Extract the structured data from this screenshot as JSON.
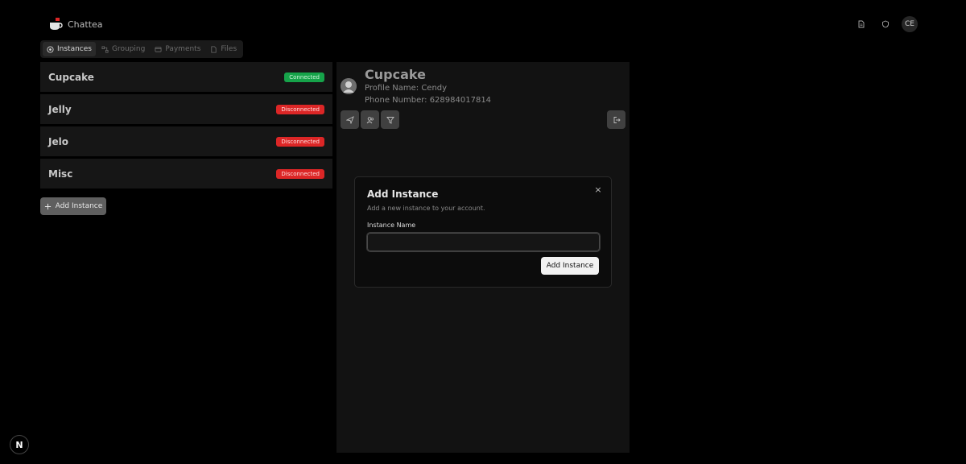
{
  "app": {
    "name": "Chattea"
  },
  "header": {
    "avatar_initials": "CE"
  },
  "tabs": [
    {
      "label": "Instances",
      "active": true
    },
    {
      "label": "Grouping",
      "active": false
    },
    {
      "label": "Payments",
      "active": false
    },
    {
      "label": "Files",
      "active": false
    }
  ],
  "instances": [
    {
      "name": "Cupcake",
      "status": "Connected"
    },
    {
      "name": "Jelly",
      "status": "Disconnected"
    },
    {
      "name": "Jelo",
      "status": "Disconnected"
    },
    {
      "name": "Misc",
      "status": "Disconnected"
    }
  ],
  "add_instance_label": "Add Instance",
  "detail": {
    "title": "Cupcake",
    "profile_name": "Profile Name: Cendy",
    "phone_number": "Phone Number: 628984017814"
  },
  "modal": {
    "title": "Add Instance",
    "description": "Add a new instance to your account.",
    "field_label": "Instance Name",
    "field_value": "",
    "submit_label": "Add Instance",
    "close_glyph": "×"
  },
  "colors": {
    "connected": "#16a34a",
    "disconnected": "#dc2626"
  },
  "corner_badge": "N"
}
